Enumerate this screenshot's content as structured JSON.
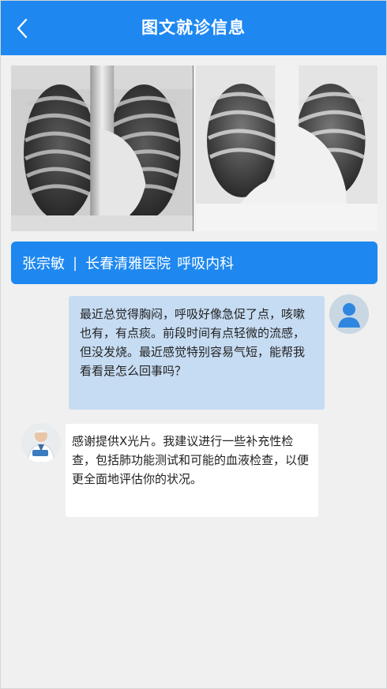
{
  "header": {
    "title": "图文就诊信息",
    "back_icon": "chevron-left-icon"
  },
  "images": [
    {
      "name": "xray-1"
    },
    {
      "name": "xray-2"
    }
  ],
  "doctor_info": {
    "name": "张宗敏",
    "separator": "|",
    "hospital": "长春清雅医院",
    "department": "呼吸内科"
  },
  "messages": [
    {
      "sender": "user",
      "text": "最近总觉得胸闷，呼吸好像急促了点，咳嗽也有，有点痰。前段时间有点轻微的流感，但没发烧。最近感觉特别容易气短，能帮我看看是怎么回事吗？"
    },
    {
      "sender": "doctor",
      "text": "感谢提供X光片。我建议进行一些补充性检查，包括肺功能测试和可能的血液检查，以便更全面地评估你的状况。"
    }
  ],
  "colors": {
    "primary": "#1e88f0",
    "user_bubble": "#c6dcf3",
    "doctor_bubble": "#ffffff",
    "background": "#f0f0f0"
  }
}
